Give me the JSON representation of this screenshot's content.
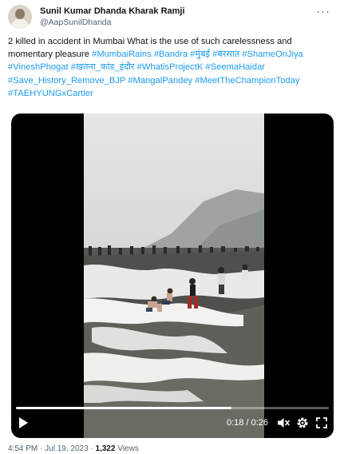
{
  "tweet": {
    "display_name": "Sunil Kumar Dhanda Kharak Ramji",
    "handle": "@AapSunilDhanda",
    "text_segments": [
      {
        "text": "2 killed in accident in Mumbai What is the use of such carelessness and momentary pleasure ",
        "tag": false
      },
      {
        "text": "#MumbaiRains",
        "tag": true
      },
      {
        "text": " ",
        "tag": false
      },
      {
        "text": "#Bandra",
        "tag": true
      },
      {
        "text": " ",
        "tag": false
      },
      {
        "text": "#मुंबई",
        "tag": true
      },
      {
        "text": " ",
        "tag": false
      },
      {
        "text": "#बरसात",
        "tag": true
      },
      {
        "text": " ",
        "tag": false
      },
      {
        "text": "#ShameOnJiya",
        "tag": true
      },
      {
        "text": " ",
        "tag": false
      },
      {
        "text": "#VineshPhogat",
        "tag": true
      },
      {
        "text": " ",
        "tag": false
      },
      {
        "text": "#खतना_कांड_इंदौर",
        "tag": true
      },
      {
        "text": " ",
        "tag": false
      },
      {
        "text": "#WhatisProjectK",
        "tag": true
      },
      {
        "text": " ",
        "tag": false
      },
      {
        "text": "#SeemaHaidar",
        "tag": true
      },
      {
        "text": " ",
        "tag": false
      },
      {
        "text": "#Save_History_Remove_BJP",
        "tag": true
      },
      {
        "text": " ",
        "tag": false
      },
      {
        "text": "#MangalPandey",
        "tag": true
      },
      {
        "text": " ",
        "tag": false
      },
      {
        "text": "#MeetTheChampionToday",
        "tag": true
      },
      {
        "text": " ",
        "tag": false
      },
      {
        "text": "#TAEHYUNGxCartier",
        "tag": true
      }
    ],
    "more_icon": "more-horizontal-icon",
    "hashtag_color": "#1d9bf0"
  },
  "video": {
    "current_time": "0:18",
    "separator": " / ",
    "duration": "0:26",
    "progress": 0.69,
    "icons": [
      "play-icon",
      "mute-icon",
      "settings-gear-icon",
      "fullscreen-icon"
    ]
  },
  "footer": {
    "time": "4:54 PM",
    "dot1": " · ",
    "date": "Jul 19, 2023",
    "dot2": " · ",
    "views_count": "1,322",
    "views_label": " Views"
  }
}
